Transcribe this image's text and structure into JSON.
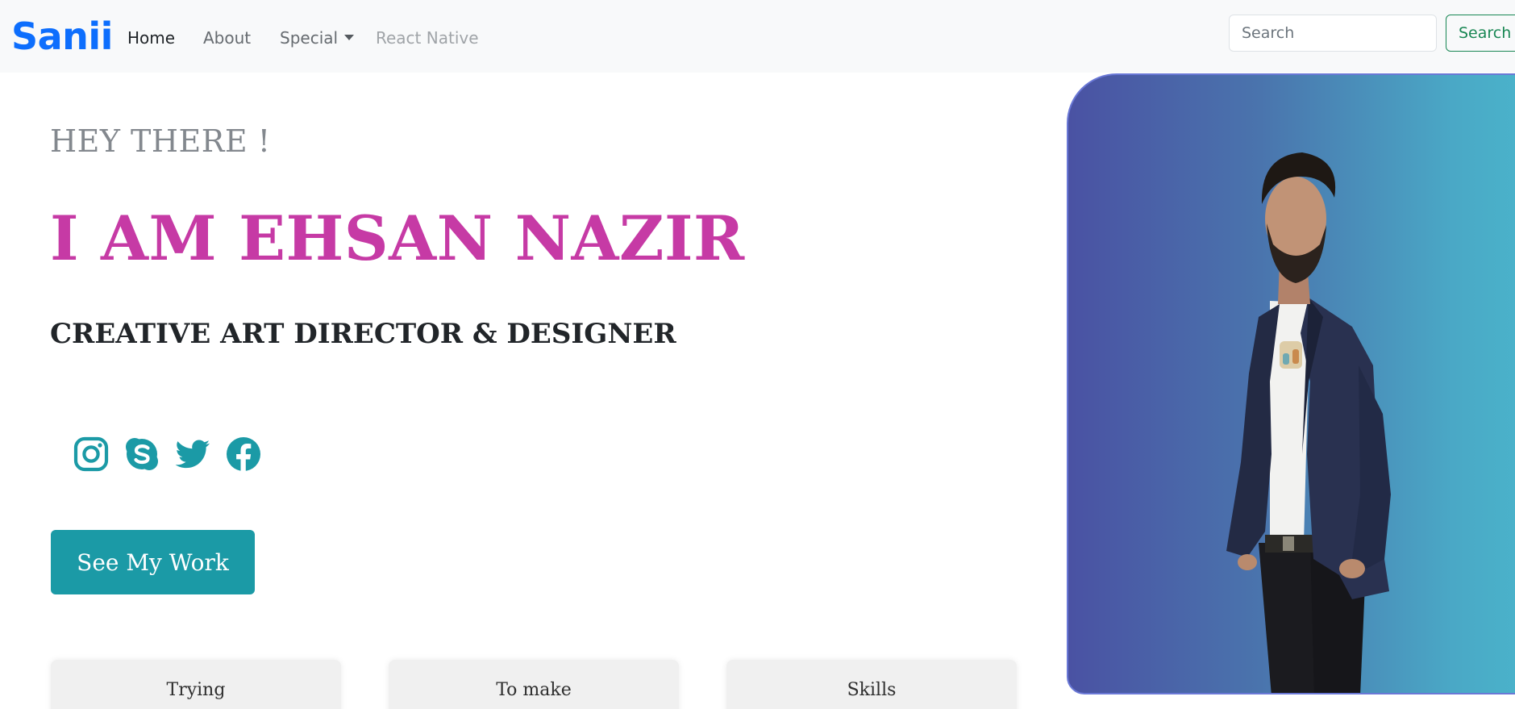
{
  "navbar": {
    "brand": "Sanii",
    "links": [
      {
        "label": "Home"
      },
      {
        "label": "About"
      },
      {
        "label": "Special"
      },
      {
        "label": "React Native"
      }
    ],
    "search_placeholder": "Search",
    "search_button": "Search"
  },
  "hero": {
    "greeting": "HEY THERE !",
    "name": "I AM EHSAN NAZIR",
    "role": "CREATIVE ART DIRECTOR & DESIGNER",
    "cta": "See My Work",
    "social": [
      {
        "icon": "instagram-icon"
      },
      {
        "icon": "skype-icon"
      },
      {
        "icon": "twitter-icon"
      },
      {
        "icon": "facebook-icon"
      }
    ]
  },
  "cards": [
    {
      "label": "Trying"
    },
    {
      "label": "To make"
    },
    {
      "label": "Skills"
    }
  ],
  "colors": {
    "brand": "#0d6efd",
    "name": "#c63aa5",
    "accent": "#1b9aa6",
    "search_button": "#198754"
  }
}
